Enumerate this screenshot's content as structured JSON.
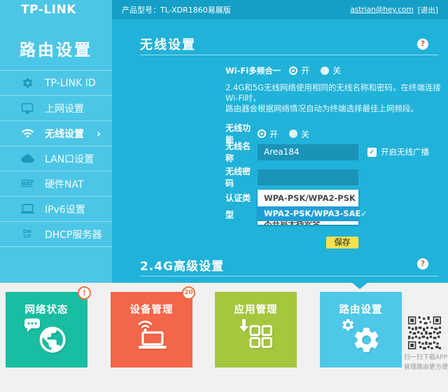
{
  "topbar": {
    "logo": "TP-LINK",
    "product_label": "产品型号：TL-XDR1860易展版",
    "account": "astrian@hey.com",
    "logout_label": "[退出]"
  },
  "sidebar": {
    "title": "路由设置",
    "chevron": "›",
    "items": [
      {
        "label": "TP-LINK ID",
        "icon": "gear-icon",
        "active": false
      },
      {
        "label": "上网设置",
        "icon": "monitor-icon",
        "active": false
      },
      {
        "label": "无线设置",
        "icon": "wifi-icon",
        "active": true
      },
      {
        "label": "LAN口设置",
        "icon": "cloud-icon",
        "active": false
      },
      {
        "label": "硬件NAT",
        "icon": "nat-icon",
        "active": false
      },
      {
        "label": "IPv6设置",
        "icon": "laptop-icon",
        "active": false
      },
      {
        "label": "DHCP服务器",
        "icon": "dhcp-icon",
        "active": false
      }
    ],
    "nat_icon_text": "NAT",
    "dhcp_icon_line1": "DH",
    "dhcp_icon_line2": "CP"
  },
  "content": {
    "section_title": "无线设置",
    "help_icon": "?",
    "multiband": {
      "label": "Wi-Fi多频合一",
      "on_label": "开",
      "off_label": "关",
      "selected": "开",
      "description_line1": "2.4G和5G无线网络使用相同的无线名称和密码，在终端连接Wi-Fi时，",
      "description_line2": "路由器会根据网络情况自动为终端选择最佳上网频段。"
    },
    "wireless_function": {
      "label": "无线功能",
      "on_label": "开",
      "off_label": "关",
      "selected": "开"
    },
    "ssid": {
      "label": "无线名称",
      "value": "Area184",
      "broadcast_label": "开启无线广播",
      "broadcast_checked": true,
      "check_icon": "✓"
    },
    "password": {
      "label": "无线密码",
      "value": ""
    },
    "auth": {
      "label": "认证类型",
      "current": "WPA-PSK/WPA2-PSK",
      "options": [
        {
          "label": "WPA2-PSK/WPA3-SAE",
          "selected": true,
          "check_icon": "✓"
        },
        {
          "label": "不开启无线安全",
          "selected": false,
          "clipped": true
        }
      ]
    },
    "save_label": "保存",
    "advanced_title": "2.4G高级设置"
  },
  "bottom_nav": {
    "tiles": [
      {
        "label": "网络状态",
        "badge": "!",
        "icon": "globe-chat-icon",
        "color": "#19bda1",
        "active": false
      },
      {
        "label": "设备管理",
        "badge": "20",
        "icon": "laptop-wifi-icon",
        "color": "#f4664a",
        "active": false
      },
      {
        "label": "应用管理",
        "badge": "",
        "icon": "apps-download-icon",
        "color": "#a5c73e",
        "active": false
      },
      {
        "label": "路由设置",
        "badge": "",
        "icon": "gears-icon",
        "color": "#4ec8e8",
        "active": true
      }
    ],
    "qr_caption_line1": "扫一扫下载APP",
    "qr_caption_line2": "管理路由更方便"
  },
  "colors": {
    "sidebar_bg": "#4cc6e6",
    "topbar_bg": "#169fc6",
    "content_bg": "#20b2d9",
    "input_bg": "#1b93b9",
    "dropdown_highlight": "#1e9ed6",
    "save_button": "#f9e24d",
    "bottom_bg": "#f1f1f1",
    "badge": "#ee7242",
    "help_mark": "#e8622d"
  }
}
